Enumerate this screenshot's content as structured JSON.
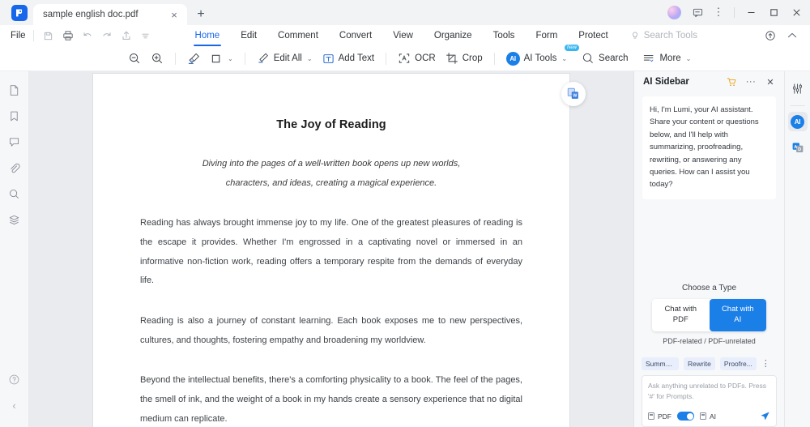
{
  "titlebar": {
    "tab_title": "sample english doc.pdf",
    "close_label": "×",
    "newtab_label": "+",
    "minimize_label": "—",
    "maximize_label": "□",
    "close_window_label": "✕",
    "more_label": "⋮"
  },
  "menubar": {
    "file_label": "File",
    "tabs": [
      {
        "label": "Home",
        "active": true
      },
      {
        "label": "Edit",
        "active": false
      },
      {
        "label": "Comment",
        "active": false
      },
      {
        "label": "Convert",
        "active": false
      },
      {
        "label": "View",
        "active": false
      },
      {
        "label": "Organize",
        "active": false
      },
      {
        "label": "Tools",
        "active": false
      },
      {
        "label": "Form",
        "active": false
      },
      {
        "label": "Protect",
        "active": false
      }
    ],
    "search_tools_label": "Search Tools"
  },
  "toolbar": {
    "zoom_out": "zoom-out",
    "zoom_in": "zoom-in",
    "highlight": "highlighter",
    "shape": "rectangle",
    "edit_all_label": "Edit All",
    "add_text_label": "Add Text",
    "ocr_label": "OCR",
    "crop_label": "Crop",
    "ai_tools_label": "AI Tools",
    "ai_tools_badge": "New",
    "search_label": "Search",
    "more_label": "More",
    "caret": "⌄"
  },
  "left_rail": {
    "items": [
      {
        "name": "thumbnails-icon"
      },
      {
        "name": "bookmark-icon"
      },
      {
        "name": "comment-icon"
      },
      {
        "name": "attachment-icon"
      },
      {
        "name": "search-icon"
      },
      {
        "name": "layers-icon"
      }
    ],
    "help_label": "?",
    "collapse_label": "‹"
  },
  "document": {
    "title": "The Joy of Reading",
    "subtitle_line1": "Diving into the pages of a well-written book opens up new worlds,",
    "subtitle_line2": "characters, and ideas, creating a magical experience.",
    "paragraphs": [
      "Reading has always brought immense joy to my life. One of the greatest pleasures of reading is the escape it provides. Whether I'm engrossed in a captivating novel or immersed in an informative non-fiction work, reading offers a temporary respite from the demands of everyday life.",
      "Reading is also a journey of constant learning. Each book exposes me to new perspectives, cultures, and thoughts, fostering empathy and broadening my worldview.",
      "Beyond the intellectual benefits, there's a comforting physicality to a book. The feel of the pages, the smell of ink, and the weight of a book in my hands create a sensory experience that no digital medium can replicate."
    ]
  },
  "ai_sidebar": {
    "title": "AI Sidebar",
    "cart_icon": "cart-icon",
    "more_label": "···",
    "close_label": "✕",
    "greeting": "Hi, I'm Lumi, your AI assistant. Share your content or questions below, and I'll help with summarizing, proofreading, rewriting, or answering any queries. How can I assist you today?",
    "choose_type_label": "Choose a Type",
    "segments": [
      {
        "line1": "Chat with",
        "line2": "PDF",
        "active": false
      },
      {
        "line1": "Chat with",
        "line2": "AI",
        "active": true
      }
    ],
    "segment_hint": "PDF-related / PDF-unrelated",
    "chips": [
      "Summa...",
      "Rewrite",
      "Proofre..."
    ],
    "chips_more": "⋮",
    "composer_placeholder": "Ask anything unrelated to PDFs. Press '#' for Prompts.",
    "toggle_left_label": "PDF",
    "toggle_right_label": "AI",
    "send_icon": "send-icon"
  },
  "right_rail": {
    "items": [
      {
        "name": "settings-sliders-icon",
        "selected": false
      },
      {
        "name": "ai-assistant-icon",
        "selected": true,
        "text": "AI"
      },
      {
        "name": "ai-translate-icon",
        "selected": false
      }
    ]
  },
  "colors": {
    "accent": "#1667ea",
    "ai_blue": "#1b7fe8",
    "chrome_bg": "#f2f3f5",
    "doc_bg": "#e9ebef",
    "chip_bg": "#e8eefb",
    "badge_new": "#38b6f0"
  }
}
